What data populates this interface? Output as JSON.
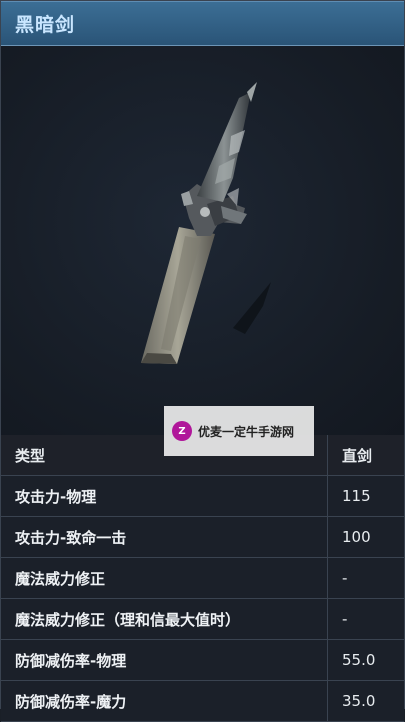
{
  "title": "黑暗剑",
  "watermark": "优麦一定牛手游网",
  "table": {
    "header": {
      "label": "类型",
      "value": "直剑"
    },
    "rows": [
      {
        "label": "攻击力-物理",
        "value": "115"
      },
      {
        "label": "攻击力-致命一击",
        "value": "100"
      },
      {
        "label": "魔法威力修正",
        "value": "-"
      },
      {
        "label": "魔法威力修正（理和信最大值时）",
        "value": "-"
      },
      {
        "label": "防御减伤率-物理",
        "value": "55.0"
      },
      {
        "label": "防御减伤率-魔力",
        "value": "35.0"
      }
    ]
  }
}
